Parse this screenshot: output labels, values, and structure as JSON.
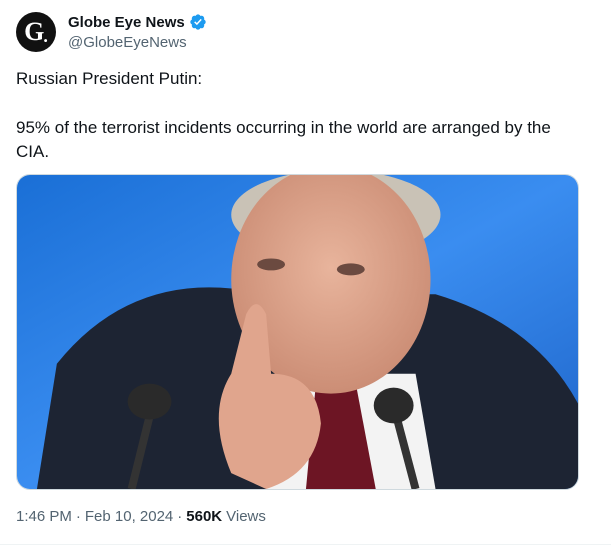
{
  "account": {
    "avatar_letter": "G",
    "avatar_dot": ".",
    "display_name": "Globe Eye News",
    "handle": "@GlobeEyeNews",
    "verified_color": "#1d9bf0"
  },
  "tweet": {
    "line1": "Russian President Putin:",
    "line2": "95% of the terrorist incidents occurring in the world are arranged by the CIA."
  },
  "media": {
    "background_color": "#2a7fe0"
  },
  "meta": {
    "time": "1:46 PM",
    "dot1": "·",
    "date": "Feb 10, 2024",
    "dot2": "·",
    "views_count": "560K",
    "views_label": "Views"
  }
}
